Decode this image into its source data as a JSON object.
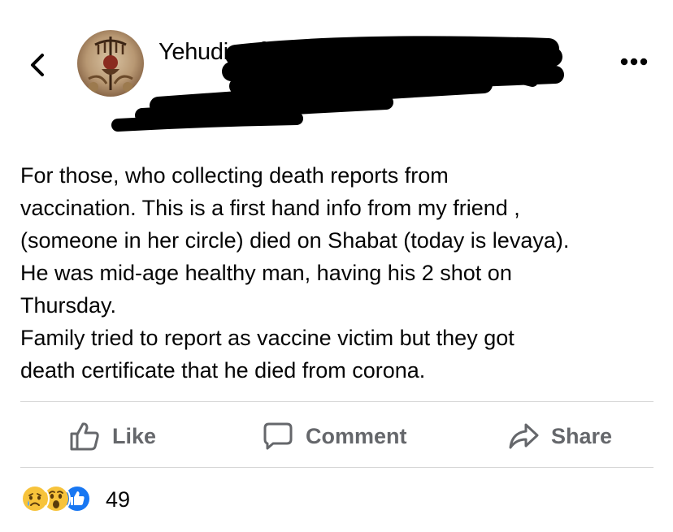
{
  "header": {
    "back_icon": "chevron-left-icon",
    "author_name": "Yehudi",
    "more_icon": "more-options-icon"
  },
  "post": {
    "lines": [
      "For those, who collecting death reports from",
      "vaccination. This is a first hand info from my friend ,",
      "(someone in her circle) died on Shabat (today is levaya).",
      "He was mid-age healthy man, having his 2 shot on",
      "Thursday.",
      "Family tried to report as vaccine victim but they got",
      "death certificate that he died from corona."
    ]
  },
  "actions": {
    "like_label": "Like",
    "comment_label": "Comment",
    "share_label": "Share"
  },
  "reactions": {
    "icons": [
      "sad-reaction-icon",
      "wow-reaction-icon",
      "like-reaction-icon"
    ],
    "count": "49"
  },
  "colors": {
    "text": "#050505",
    "secondary": "#65676b",
    "like_blue": "#1877f2",
    "divider": "#d6d6d6"
  }
}
